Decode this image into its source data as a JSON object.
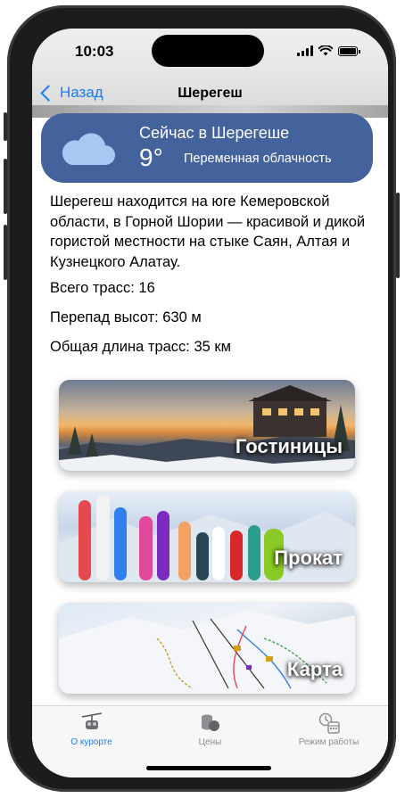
{
  "status_bar": {
    "time": "10:03"
  },
  "nav": {
    "back_label": "Назад",
    "title": "Шерегеш"
  },
  "weather": {
    "title": "Сейчас в Шерегеше",
    "temperature": "9°",
    "condition": "Переменная облачность",
    "icon": "cloud-icon",
    "background_color": "#44629b"
  },
  "info": {
    "description": "Шерегеш находится на юге Кемеровской области, в Горной Шории — красивой и дикой гористой местности на стыке Саян, Алтая и Кузнецкого Алатау.",
    "trails_count": "Всего трасс: 16",
    "elevation_drop": "Перепад высот: 630 м",
    "trails_length": "Общая длина трасс: 35 км"
  },
  "cards": [
    {
      "label": "Гостиницы"
    },
    {
      "label": "Прокат"
    },
    {
      "label": "Карта"
    }
  ],
  "tabbar": {
    "accent_color": "#1e7cf0",
    "items": [
      {
        "label": "О курорте",
        "icon": "ski-lift-icon",
        "active": true
      },
      {
        "label": "Цены",
        "icon": "coins-icon",
        "active": false
      },
      {
        "label": "Режим работы",
        "icon": "clock-calendar-icon",
        "active": false
      }
    ]
  }
}
